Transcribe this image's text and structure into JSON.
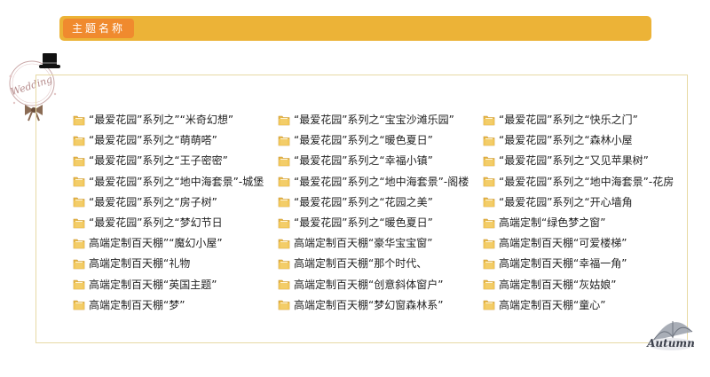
{
  "title": "主题名称",
  "colors": {
    "title_bar": "#ecb337",
    "title_pill": "#f08a2e",
    "frame": "#e7d9a4",
    "folder": "#e8b94a"
  },
  "decor": {
    "wedding_text": "Wedding",
    "autumn_text": "Autumn"
  },
  "columns": [
    [
      "“最爱花园”系列之”“米奇幻想”",
      "“最爱花园”系列之“萌萌嗒”",
      "“最爱花园”系列之“王子密密”",
      "“最爱花园”系列之“地中海套景”-城堡",
      "“最爱花园”系列之“房子树”",
      "“最爱花园”系列之“梦幻节日",
      "高端定制百天棚”“魔幻小屋”",
      "高端定制百天棚“礼物",
      "高端定制百天棚“英国主题”",
      "高端定制百天棚“梦”"
    ],
    [
      "“最爱花园”系列之“宝宝沙滩乐园”",
      "“最爱花园”系列之“暖色夏日”",
      "“最爱花园”系列之“幸福小镇”",
      "“最爱花园”系列之“地中海套景”-阁楼",
      "“最爱花园”系列之“花园之美”",
      "“最爱花园”系列之“暖色夏日”",
      "高端定制百天棚“豪华宝宝窗”",
      "高端定制百天棚“那个时代、",
      "高端定制百天棚“创意斜体窗户”",
      "高端定制百天棚“梦幻窗森林系”"
    ],
    [
      "“最爱花园”系列之“快乐之门”",
      "“最爱花园”系列之“森林小屋",
      "“最爱花园”系列之“又见苹果树”",
      "“最爱花园”系列之“地中海套景”-花房",
      "“最爱花园”系列之“开心墙角",
      "高端定制“绿色梦之窗”",
      "高端定制百天棚“可爱楼梯”",
      "高端定制百天棚“幸福一角”",
      "高端定制百天棚“灰姑娘”",
      "高端定制百天棚“童心”"
    ]
  ]
}
